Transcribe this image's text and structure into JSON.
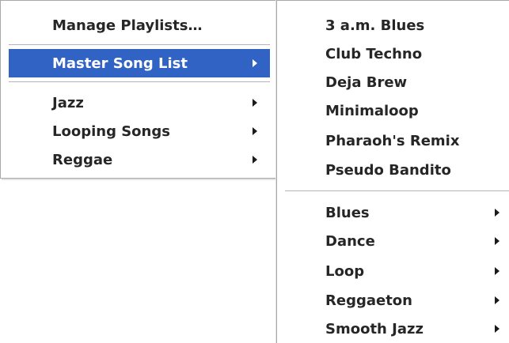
{
  "colors": {
    "highlight": "#3163c4",
    "highlight_text": "#ffffff",
    "text": "#262626",
    "border": "#a8a8a8"
  },
  "playlist_menu": {
    "manage_label": "Manage Playlists…",
    "master_label": "Master Song List",
    "items": [
      {
        "label": "Jazz",
        "icon": "submenu-arrow-icon"
      },
      {
        "label": "Looping Songs",
        "icon": "submenu-arrow-icon"
      },
      {
        "label": "Reggae",
        "icon": "submenu-arrow-icon"
      }
    ]
  },
  "song_menu": {
    "songs": [
      {
        "label": "3 a.m. Blues"
      },
      {
        "label": "Club Techno"
      },
      {
        "label": "Deja Brew"
      },
      {
        "label": "Minimaloop"
      },
      {
        "label": "Pharaoh's Remix"
      },
      {
        "label": "Pseudo Bandito"
      }
    ],
    "genres": [
      {
        "label": "Blues",
        "icon": "submenu-arrow-icon"
      },
      {
        "label": "Dance",
        "icon": "submenu-arrow-icon"
      },
      {
        "label": "Loop",
        "icon": "submenu-arrow-icon"
      },
      {
        "label": "Reggaeton",
        "icon": "submenu-arrow-icon"
      },
      {
        "label": "Smooth Jazz",
        "icon": "submenu-arrow-icon"
      }
    ]
  }
}
